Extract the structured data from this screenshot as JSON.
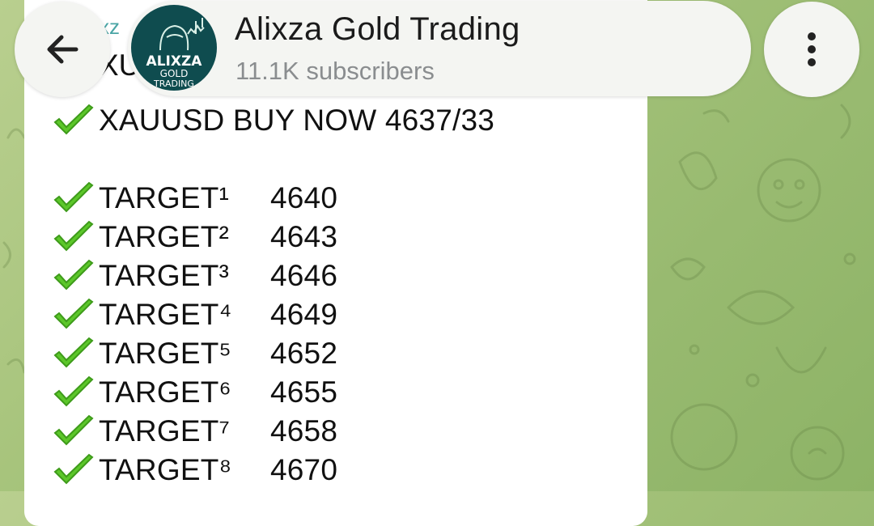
{
  "header": {
    "back_icon": "arrow-left-icon",
    "channel_name": "Alixza Gold Trading",
    "subscribers": "11.1K subscribers",
    "menu_icon": "more-vertical-icon",
    "avatar": {
      "line1": "ALIXZA",
      "line2": "GOLD",
      "line3": "TRADING"
    }
  },
  "message": {
    "partial_sender": "xz",
    "partial_line": "XU",
    "signal": "XAUUSD BUY NOW 4637/33",
    "check_icon": "check-mark-icon",
    "targets": [
      {
        "label": "TARGET¹",
        "value": "4640"
      },
      {
        "label": "TARGET²",
        "value": "4643"
      },
      {
        "label": "TARGET³",
        "value": "4646"
      },
      {
        "label": "TARGET⁴",
        "value": "4649"
      },
      {
        "label": "TARGET⁵",
        "value": "4652"
      },
      {
        "label": "TARGET⁶",
        "value": "4655"
      },
      {
        "label": "TARGET⁷",
        "value": "4658"
      },
      {
        "label": "TARGET⁸",
        "value": "4670"
      }
    ]
  },
  "colors": {
    "accent": "#4aa5a5",
    "check_green": "#5cc72a",
    "wallpaper": "#a7c47c",
    "avatar_bg": "#0f4c4f"
  }
}
